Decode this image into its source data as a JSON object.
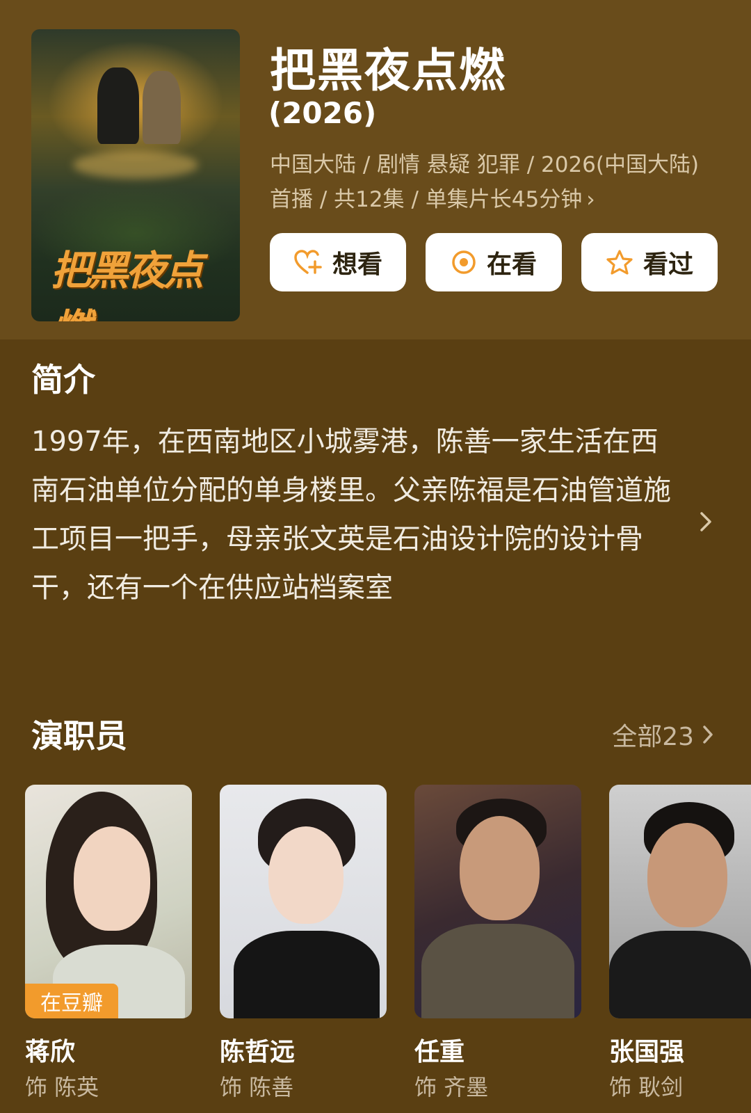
{
  "show": {
    "title": "把黑夜点燃",
    "year": "(2026)",
    "meta_line1": "中国大陆 / 剧情 悬疑 犯罪 / 2026(中国大陆)",
    "meta_line2": "首播 / 共12集 / 单集片长45分钟",
    "poster_title": "把黑夜点燃"
  },
  "actions": {
    "want": "想看",
    "watching": "在看",
    "watched": "看过"
  },
  "intro": {
    "heading": "简介",
    "text": "1997年，在西南地区小城雾港，陈善一家生活在西南石油单位分配的单身楼里。父亲陈福是石油管道施工项目一把手，母亲张文英是石油设计院的设计骨干，还有一个在供应站档案室"
  },
  "cast": {
    "heading": "演职员",
    "all_label": "全部23",
    "members": [
      {
        "name": "蒋欣",
        "role": "饰 陈英",
        "tag": "在豆瓣"
      },
      {
        "name": "陈哲远",
        "role": "饰 陈善"
      },
      {
        "name": "任重",
        "role": "饰 齐墨"
      },
      {
        "name": "张国强",
        "role": "饰 耿剑"
      }
    ]
  },
  "colors": {
    "background": "#5a3f12",
    "header": "#694c1b",
    "accent": "#f29b2c",
    "muted_text": "#c9b9a0"
  },
  "icons": {
    "want": "heart-plus-icon",
    "watching": "target-dot-icon",
    "watched": "star-outline-icon",
    "more": "chevron-right-icon"
  }
}
